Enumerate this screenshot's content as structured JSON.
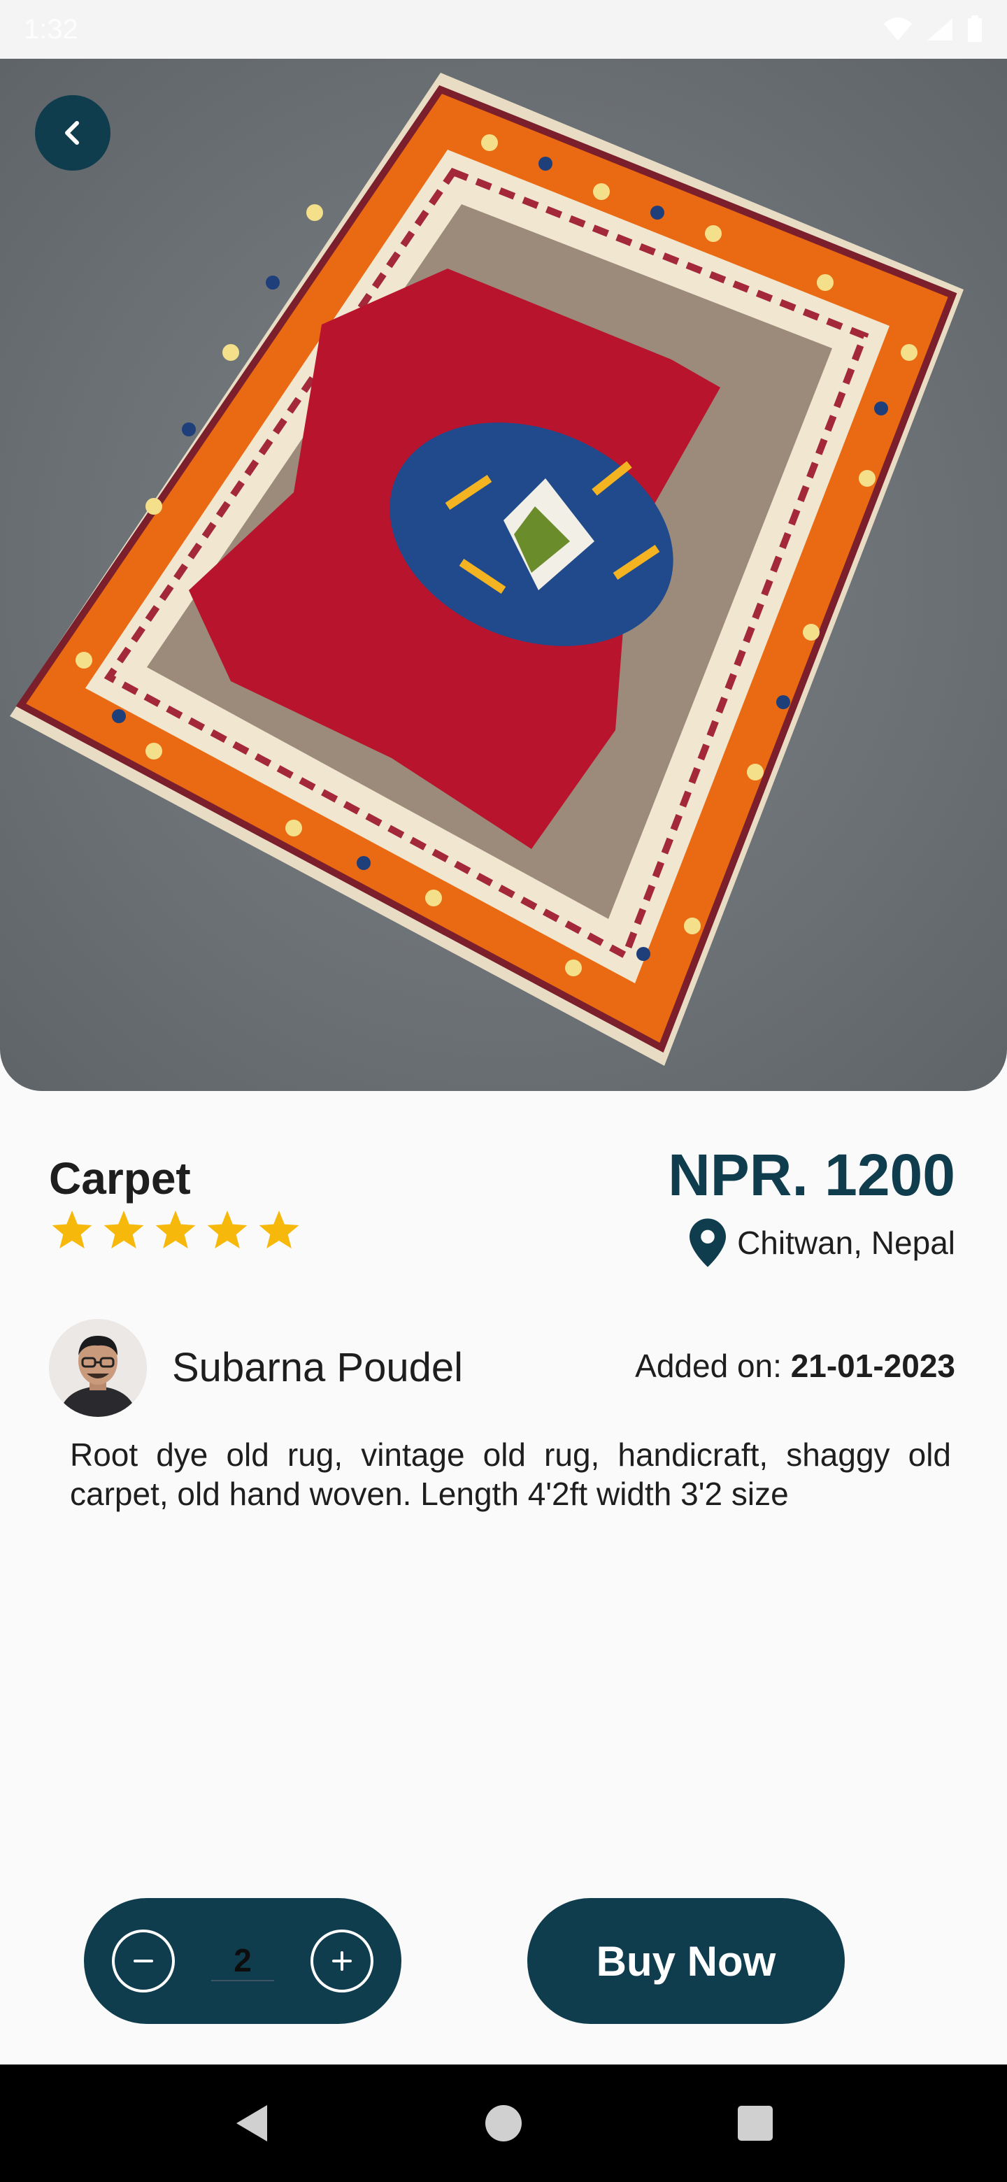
{
  "status_bar": {
    "time": "1:32"
  },
  "product": {
    "title": "Carpet",
    "rating": 5,
    "price": "NPR. 1200",
    "location": "Chitwan, Nepal",
    "description": "Root dye old rug, vintage old rug, handicraft, shaggy old carpet, old hand woven. Length 4'2ft width 3'2 size"
  },
  "seller": {
    "name": "Subarna Poudel",
    "added_label": "Added on:",
    "added_date": "21-01-2023"
  },
  "quantity": {
    "value": "2"
  },
  "actions": {
    "buy_label": "Buy Now"
  },
  "colors": {
    "primary": "#0f3d4e",
    "star": "#f6b90b",
    "background": "#fafafa"
  },
  "icons": {
    "back": "chevron-left-icon",
    "location": "map-pin-icon",
    "minus": "minus-circle-icon",
    "plus": "plus-circle-icon"
  }
}
